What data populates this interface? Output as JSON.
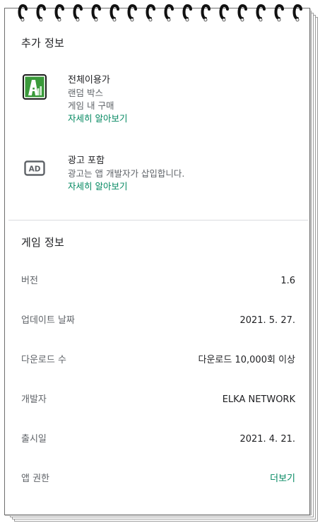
{
  "extra_info": {
    "title": "추가 정보",
    "rating": {
      "title": "전체이용가",
      "lines": [
        "랜덤 박스",
        "게임 내 구매"
      ],
      "link": "자세히 알아보기"
    },
    "ads": {
      "title": "광고 포함",
      "description": "광고는 앱 개발자가 삽입합니다.",
      "link": "자세히 알아보기",
      "icon_text": "AD"
    }
  },
  "game_info": {
    "title": "게임 정보",
    "rows": [
      {
        "label": "버전",
        "value": "1.6"
      },
      {
        "label": "업데이트 날짜",
        "value": "2021. 5. 27."
      },
      {
        "label": "다운로드 수",
        "value": "다운로드 10,000회 이상"
      },
      {
        "label": "개발자",
        "value": "ELKA NETWORK"
      },
      {
        "label": "출시일",
        "value": "2021. 4. 21."
      },
      {
        "label": "앱 권한",
        "value": "더보기"
      }
    ]
  },
  "colors": {
    "link": "#01875f",
    "rating_green": "#3a9a3a"
  },
  "icons": {
    "rating": "age-rating-all-icon",
    "ads": "ad-icon",
    "binding": "spiral-ring-icon"
  }
}
